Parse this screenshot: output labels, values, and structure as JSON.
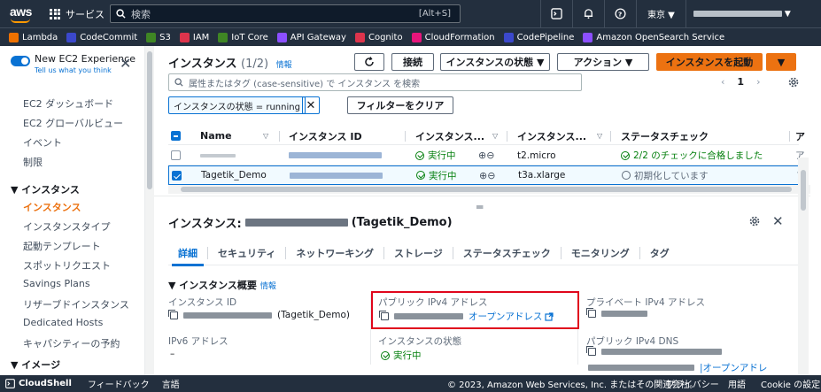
{
  "topnav": {
    "logo_text": "aws",
    "services_label": "サービス",
    "search_placeholder": "検索",
    "search_shortcut": "[Alt+S]",
    "region": "東京 ▼"
  },
  "favorites": [
    {
      "label": "Lambda",
      "color": "#ed7100"
    },
    {
      "label": "CodeCommit",
      "color": "#3b48cc"
    },
    {
      "label": "S3",
      "color": "#3f8624"
    },
    {
      "label": "IAM",
      "color": "#dd344c"
    },
    {
      "label": "IoT Core",
      "color": "#3f8624"
    },
    {
      "label": "API Gateway",
      "color": "#8c4fff"
    },
    {
      "label": "Cognito",
      "color": "#dd344c"
    },
    {
      "label": "CloudFormation",
      "color": "#e7157b"
    },
    {
      "label": "CodePipeline",
      "color": "#3b48cc"
    },
    {
      "label": "Amazon OpenSearch Service",
      "color": "#8c4fff"
    }
  ],
  "sidebar": {
    "toggle_title": "New EC2 Experience",
    "toggle_sub": "Tell us what you think",
    "items_top": [
      "EC2 ダッシュボード",
      "EC2 グローバルビュー",
      "イベント",
      "制限"
    ],
    "section_instances": "▼ インスタンス",
    "items_instances": [
      "インスタンス",
      "インスタンスタイプ",
      "起動テンプレート",
      "スポットリクエスト",
      "Savings Plans",
      "リザーブドインスタンス",
      "Dedicated Hosts",
      "キャパシティーの予約"
    ],
    "section_images": "▼ イメージ"
  },
  "list": {
    "title": "インスタンス",
    "count": "(1/2)",
    "info": "情報",
    "btn_refresh": "C",
    "btn_connect": "接続",
    "btn_state": "インスタンスの状態 ▼",
    "btn_action": "アクション ▼",
    "btn_launch": "インスタンスを起動",
    "btn_launch_caret": "▼",
    "search_placeholder": "属性またはタグ (case-sensitive) で インスタンス を検索",
    "page": "1",
    "filter_chip": "インスタンスの状態 = running",
    "clear_filters": "フィルターをクリア",
    "columns": [
      "Name",
      "インスタンス ID",
      "インスタンス...",
      "インスタンス...",
      "ステータスチェック",
      "ア"
    ],
    "rows": [
      {
        "name": "",
        "state": "実行中",
        "type": "t2.micro",
        "status": "2/2 のチェックに合格しました",
        "status_ok": true,
        "checked": false,
        "last": "ア"
      },
      {
        "name": "Tagetik_Demo",
        "state": "実行中",
        "type": "t3a.xlarge",
        "status": "初期化しています",
        "status_ok": false,
        "checked": true,
        "last": "ア"
      }
    ]
  },
  "detail": {
    "title_prefix": "インスタンス:",
    "title_suffix": "(Tagetik_Demo)",
    "tabs": [
      "詳細",
      "セキュリティ",
      "ネットワーキング",
      "ストレージ",
      "ステータスチェック",
      "モニタリング",
      "タグ"
    ],
    "section": "▼ インスタンス概要",
    "section_info": "情報",
    "instance_id_label": "インスタンス ID",
    "instance_id_suffix": "(Tagetik_Demo)",
    "public_ipv4_label": "パブリック IPv4 アドレス",
    "open_address": "オープンアドレス",
    "private_ipv4_label": "プライベート IPv4 アドレス",
    "ipv6_label": "IPv6 アドレス",
    "ipv6_value": "–",
    "state_label": "インスタンスの状態",
    "state_value": "実行中",
    "public_dns_label": "パブリック IPv4 DNS",
    "open_address_2": "|オープンアドレ"
  },
  "footer": {
    "cloudshell": "CloudShell",
    "feedback": "フィードバック",
    "language": "言語",
    "copyright": "© 2023, Amazon Web Services, Inc. またはその関連会社。",
    "privacy": "プライバシー",
    "terms": "用語",
    "cookie": "Cookie の設定"
  }
}
